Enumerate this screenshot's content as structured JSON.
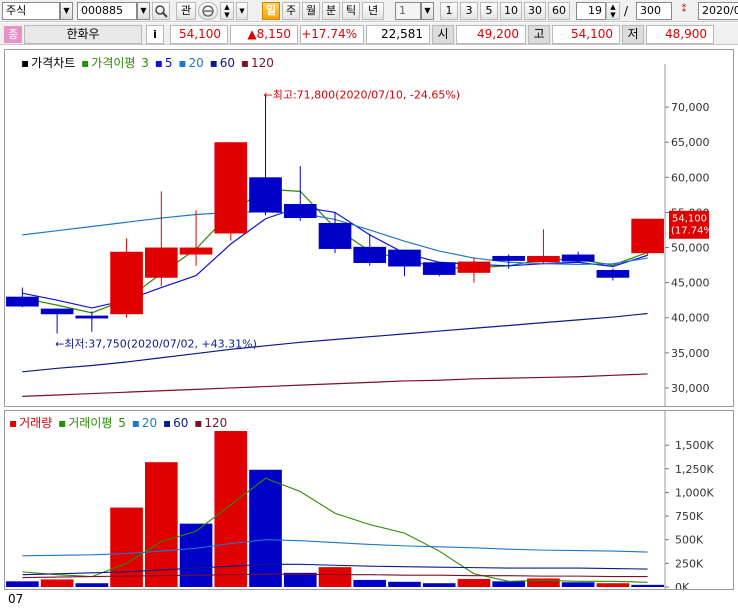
{
  "toolbar": {
    "market": "주식",
    "code": "000885",
    "search_icon": "magnifier-icon",
    "watch_btn": "관",
    "sync_icon": "sync-icon",
    "updown_icon": "spinner-icon",
    "dropdown_icon": "chevron-down-icon",
    "periods": [
      "일",
      "주",
      "월",
      "분",
      "틱",
      "년"
    ],
    "active_period": "일",
    "interval_value": "1",
    "interval_presets": [
      "1",
      "3",
      "5",
      "10",
      "30",
      "60"
    ],
    "display_count": "19",
    "total_count": "300",
    "date_value": "2020/0"
  },
  "quote": {
    "badge": "종",
    "name": "한화우",
    "info_btn": "i",
    "price": "54,100",
    "change": "▲8,150",
    "change_rate": "+17.74%",
    "volume": "22,581",
    "open_label": "시",
    "open": "49,200",
    "high_label": "고",
    "high": "54,100",
    "low_label": "저",
    "low": "48,900"
  },
  "colors": {
    "up": "#e00000",
    "down": "#0000c8",
    "ma3": "#2e8b00",
    "ma5": "#1010dd",
    "ma20": "#1e78c8",
    "ma60": "#0a1a8a",
    "ma120": "#7a1028"
  },
  "chart_data": [
    {
      "type": "candlestick",
      "legend": [
        "가격차트",
        "가격이평",
        "3",
        "5",
        "20",
        "60",
        "120"
      ],
      "y_ticks": [
        "70,000",
        "65,000",
        "60,000",
        "55,000",
        "50,000",
        "45,000",
        "40,000",
        "35,000",
        "30,000"
      ],
      "ylim": [
        28000,
        75000
      ],
      "candles": [
        {
          "o": 43000,
          "h": 44300,
          "l": 41500,
          "c": 41600
        },
        {
          "o": 41300,
          "h": 41300,
          "l": 37750,
          "c": 40500
        },
        {
          "o": 40300,
          "h": 40900,
          "l": 38000,
          "c": 39900
        },
        {
          "o": 40500,
          "h": 51300,
          "l": 40000,
          "c": 49400
        },
        {
          "o": 45700,
          "h": 58000,
          "l": 44500,
          "c": 50000
        },
        {
          "o": 49000,
          "h": 55300,
          "l": 47400,
          "c": 50000
        },
        {
          "o": 52000,
          "h": 65000,
          "l": 51000,
          "c": 65000
        },
        {
          "o": 60000,
          "h": 71800,
          "l": 54600,
          "c": 55000
        },
        {
          "o": 56200,
          "h": 61600,
          "l": 53800,
          "c": 54200
        },
        {
          "o": 53500,
          "h": 55000,
          "l": 49200,
          "c": 49800
        },
        {
          "o": 50100,
          "h": 51900,
          "l": 47400,
          "c": 47800
        },
        {
          "o": 49700,
          "h": 49700,
          "l": 45900,
          "c": 47300
        },
        {
          "o": 47900,
          "h": 47900,
          "l": 45900,
          "c": 46100
        },
        {
          "o": 46400,
          "h": 48600,
          "l": 45000,
          "c": 48000
        },
        {
          "o": 48800,
          "h": 49000,
          "l": 47000,
          "c": 48100
        },
        {
          "o": 47900,
          "h": 52600,
          "l": 47600,
          "c": 48800
        },
        {
          "o": 49000,
          "h": 49400,
          "l": 47800,
          "c": 48000
        },
        {
          "o": 46800,
          "h": 47000,
          "l": 45300,
          "c": 45700
        },
        {
          "o": 49200,
          "h": 54100,
          "l": 48900,
          "c": 54100
        }
      ],
      "ma": {
        "3": [
          42800,
          41800,
          40700,
          42600,
          46300,
          49800,
          55000,
          58300,
          58000,
          52800,
          49500,
          48300,
          47100,
          47100,
          47400,
          48300,
          48300,
          47500,
          49300
        ],
        "5": [
          43500,
          42500,
          41400,
          42500,
          44300,
          46000,
          50500,
          54100,
          55800,
          55000,
          51800,
          49200,
          47900,
          47600,
          47400,
          47700,
          47900,
          47300,
          48900
        ],
        "20": [
          51800,
          52400,
          53000,
          53600,
          54200,
          54700,
          55000,
          55100,
          54900,
          54000,
          52500,
          50900,
          49500,
          48500,
          47900,
          47700,
          47600,
          47700,
          48500
        ],
        "60": [
          32300,
          32800,
          33200,
          33700,
          34300,
          34900,
          35500,
          36000,
          36500,
          36900,
          37300,
          37700,
          38100,
          38500,
          38900,
          39300,
          39700,
          40100,
          40600
        ],
        "120": [
          28800,
          29000,
          29200,
          29400,
          29600,
          29800,
          30000,
          30200,
          30400,
          30600,
          30800,
          31000,
          31100,
          31300,
          31400,
          31500,
          31600,
          31800,
          32000
        ]
      },
      "annotations": {
        "high": "←최고:71,800(2020/07/10, -24.65%)",
        "low": "←최저:37,750(2020/07/02, +43.31%)",
        "last_price": "54,100",
        "last_rate": "(17.74%)"
      }
    },
    {
      "type": "bar",
      "legend": [
        "거래량",
        "거래이평",
        "5",
        "20",
        "60",
        "120"
      ],
      "y_ticks": [
        "1,500K",
        "1,250K",
        "1,000K",
        "750K",
        "500K",
        "250K",
        "0K"
      ],
      "ylim": [
        0,
        1650000
      ],
      "volumes": [
        60000,
        80000,
        40000,
        840000,
        1320000,
        670000,
        1650000,
        1240000,
        150000,
        210000,
        75000,
        55000,
        40000,
        85000,
        60000,
        90000,
        50000,
        40000,
        22581
      ],
      "direction": [
        "down",
        "up",
        "down",
        "up",
        "up",
        "down",
        "up",
        "down",
        "down",
        "up",
        "down",
        "down",
        "down",
        "up",
        "down",
        "up",
        "down",
        "up",
        "down"
      ],
      "ma": {
        "5": [
          160000,
          130000,
          110000,
          250000,
          480000,
          590000,
          870000,
          1150000,
          1010000,
          780000,
          660000,
          570000,
          380000,
          140000,
          60000,
          70000,
          60000,
          60000,
          50000
        ],
        "20": [
          330000,
          335000,
          340000,
          355000,
          380000,
          410000,
          460000,
          500000,
          490000,
          470000,
          450000,
          435000,
          425000,
          415000,
          400000,
          390000,
          385000,
          380000,
          370000
        ],
        "60": [
          130000,
          140000,
          150000,
          160000,
          180000,
          200000,
          220000,
          240000,
          240000,
          230000,
          220000,
          215000,
          210000,
          205000,
          200000,
          200000,
          200000,
          195000,
          190000
        ],
        "120": [
          100000,
          105000,
          110000,
          115000,
          120000,
          125000,
          130000,
          135000,
          135000,
          130000,
          130000,
          125000,
          125000,
          120000,
          120000,
          115000,
          115000,
          110000,
          110000
        ]
      },
      "x_label": "07"
    }
  ]
}
